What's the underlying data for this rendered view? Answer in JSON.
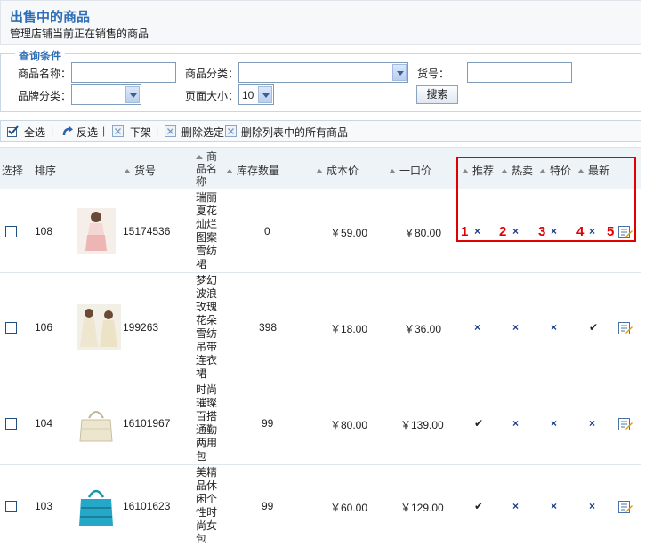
{
  "header": {
    "title": "出售中的商品",
    "subtitle": "管理店铺当前正在销售的商品"
  },
  "query": {
    "legend": "查询条件",
    "name_label": "商品名称：",
    "category_label": "商品分类：",
    "sku_label": "货号：",
    "brand_label": "品牌分类：",
    "pagesize_label": "页面大小：",
    "pagesize_value": "10",
    "search_button": "搜索"
  },
  "toolbar": {
    "select_all": "全选",
    "invert": "反选",
    "off_shelf": "下架",
    "delete_selected": "删除选定",
    "delete_all": "删除列表中的所有商品",
    "separator": "|"
  },
  "table": {
    "headers": {
      "select": "选择",
      "order": "排序",
      "sku": "货号",
      "name": "商品名称",
      "stock": "库存数量",
      "cost": "成本价",
      "price": "一口价",
      "recommend": "推荐",
      "hot": "热卖",
      "special": "特价",
      "new": "最新"
    },
    "rows": [
      {
        "order": "108",
        "sku": "15174536",
        "name": "瑞丽夏花灿烂图案雪纺裙",
        "stock": "0",
        "cost": "￥59.00",
        "price": "￥80.00",
        "flags": [
          "×",
          "×",
          "×",
          "×"
        ]
      },
      {
        "order": "106",
        "sku": "199263",
        "name": "梦幻波浪玫瑰花朵雪纺吊带连衣裙",
        "stock": "398",
        "cost": "￥18.00",
        "price": "￥36.00",
        "flags": [
          "×",
          "×",
          "×",
          "✔"
        ]
      },
      {
        "order": "104",
        "sku": "16101967",
        "name": "时尚璀璨百搭通勤两用包",
        "stock": "99",
        "cost": "￥80.00",
        "price": "￥139.00",
        "flags": [
          "✔",
          "×",
          "×",
          "×"
        ]
      },
      {
        "order": "103",
        "sku": "16101623",
        "name": "美精品休闲个性时尚女包",
        "stock": "99",
        "cost": "￥60.00",
        "price": "￥129.00",
        "flags": [
          "✔",
          "×",
          "×",
          "×"
        ]
      }
    ]
  },
  "annotation": {
    "numbers": [
      "1",
      "2",
      "3",
      "4",
      "5"
    ],
    "color": "#e00000"
  },
  "icons": [
    "checkbox-icon",
    "invert-arrow-icon",
    "delete-box-icon",
    "edit-icon",
    "dropdown-arrow-icon",
    "sort-arrow-icon"
  ],
  "colors": {
    "title": "#2e6fb7",
    "cross": "#1c3e86"
  }
}
